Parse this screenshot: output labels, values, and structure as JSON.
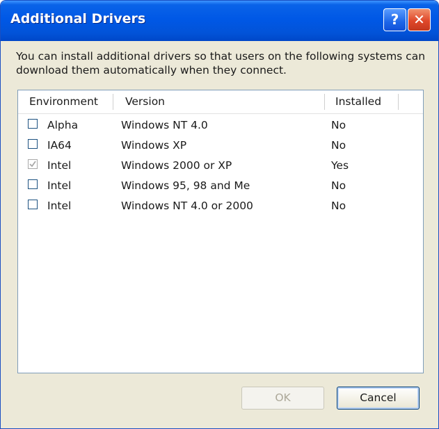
{
  "window": {
    "title": "Additional Drivers",
    "help_label": "?",
    "close_label": "✕"
  },
  "description": "You can install additional drivers so that users on the following systems can download them automatically when they connect.",
  "list": {
    "headers": {
      "environment": "Environment",
      "version": "Version",
      "installed": "Installed"
    },
    "rows": [
      {
        "checked": false,
        "environment": "Alpha",
        "version": "Windows NT 4.0",
        "installed": "No"
      },
      {
        "checked": false,
        "environment": "IA64",
        "version": "Windows XP",
        "installed": "No"
      },
      {
        "checked": true,
        "disabled": true,
        "environment": "Intel",
        "version": "Windows 2000 or XP",
        "installed": "Yes"
      },
      {
        "checked": false,
        "environment": "Intel",
        "version": "Windows 95, 98 and Me",
        "installed": "No"
      },
      {
        "checked": false,
        "environment": "Intel",
        "version": "Windows NT 4.0 or 2000",
        "installed": "No"
      }
    ]
  },
  "buttons": {
    "ok": "OK",
    "cancel": "Cancel"
  },
  "colors": {
    "titlebar": "#0058e6",
    "close": "#e0482a",
    "client": "#ece9d8"
  }
}
